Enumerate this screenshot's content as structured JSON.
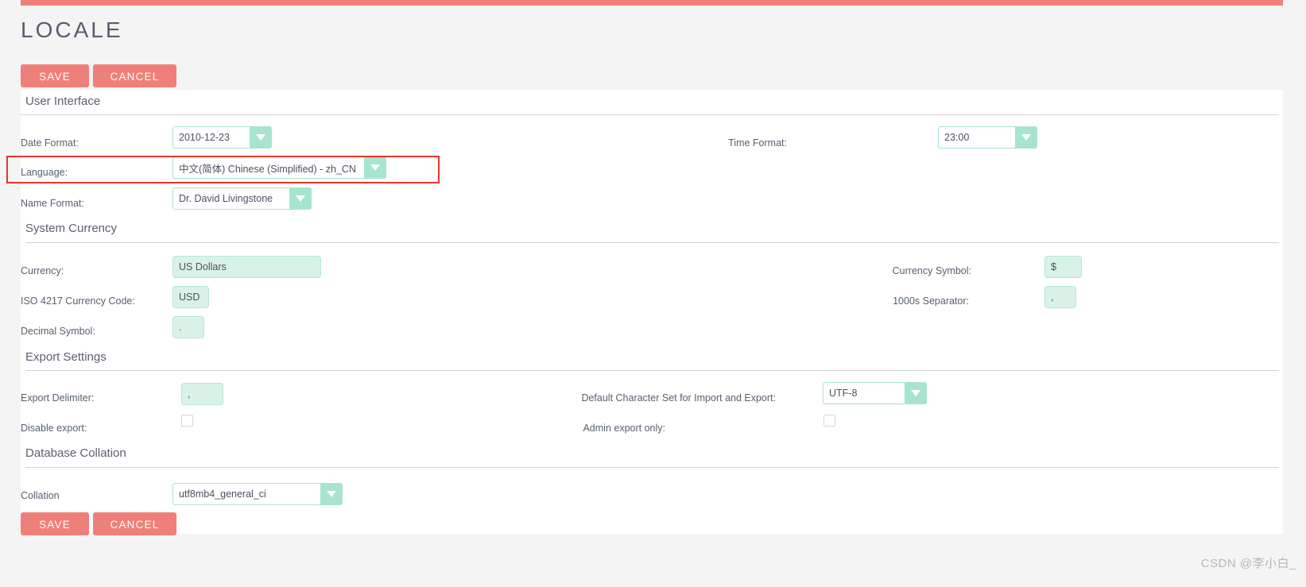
{
  "page": {
    "title": "LOCALE",
    "accent_color": "#ef8079",
    "mint_color": "#a7e4cf",
    "input_fill_color": "#d9f2e7",
    "annotation_color": "#e8352c"
  },
  "toolbar_top": {
    "save_label": "SAVE",
    "cancel_label": "CANCEL"
  },
  "toolbar_bottom": {
    "save_label": "SAVE",
    "cancel_label": "CANCEL"
  },
  "sections": {
    "user_interface": {
      "title": "User Interface",
      "fields": {
        "date_format": {
          "label": "Date Format:",
          "value": "2010-12-23",
          "arrow_icon": "chevron-down-icon"
        },
        "time_format": {
          "label": "Time Format:",
          "value": "23:00",
          "arrow_icon": "chevron-down-icon"
        },
        "language": {
          "label": "Language:",
          "value": "中文(简体) Chinese (Simplified) - zh_CN",
          "arrow_icon": "chevron-down-icon"
        },
        "name_format": {
          "label": "Name Format:",
          "value": "Dr. David Livingstone",
          "arrow_icon": "chevron-down-icon"
        }
      }
    },
    "system_currency": {
      "title": "System Currency",
      "fields": {
        "currency": {
          "label": "Currency:",
          "value": "US Dollars"
        },
        "currency_symbol": {
          "label": "Currency Symbol:",
          "value": "$"
        },
        "iso_code": {
          "label": "ISO 4217 Currency Code:",
          "value": "USD"
        },
        "thousands_separator": {
          "label": "1000s Separator:",
          "value": ","
        },
        "decimal_symbol": {
          "label": "Decimal Symbol:",
          "value": "."
        }
      }
    },
    "export_settings": {
      "title": "Export Settings",
      "fields": {
        "export_delimiter": {
          "label": "Export Delimiter:",
          "value": ","
        },
        "default_charset": {
          "label": "Default Character Set for Import and Export:",
          "value": "UTF-8",
          "arrow_icon": "chevron-down-icon"
        },
        "disable_export": {
          "label": "Disable export:",
          "checked": false
        },
        "admin_export_only": {
          "label": "Admin export only:",
          "checked": false
        }
      }
    },
    "database_collation": {
      "title": "Database Collation",
      "fields": {
        "collation": {
          "label": "Collation",
          "value": "utf8mb4_general_ci",
          "arrow_icon": "chevron-down-icon"
        }
      }
    }
  },
  "watermark": {
    "text": "CSDN @李小白_"
  }
}
